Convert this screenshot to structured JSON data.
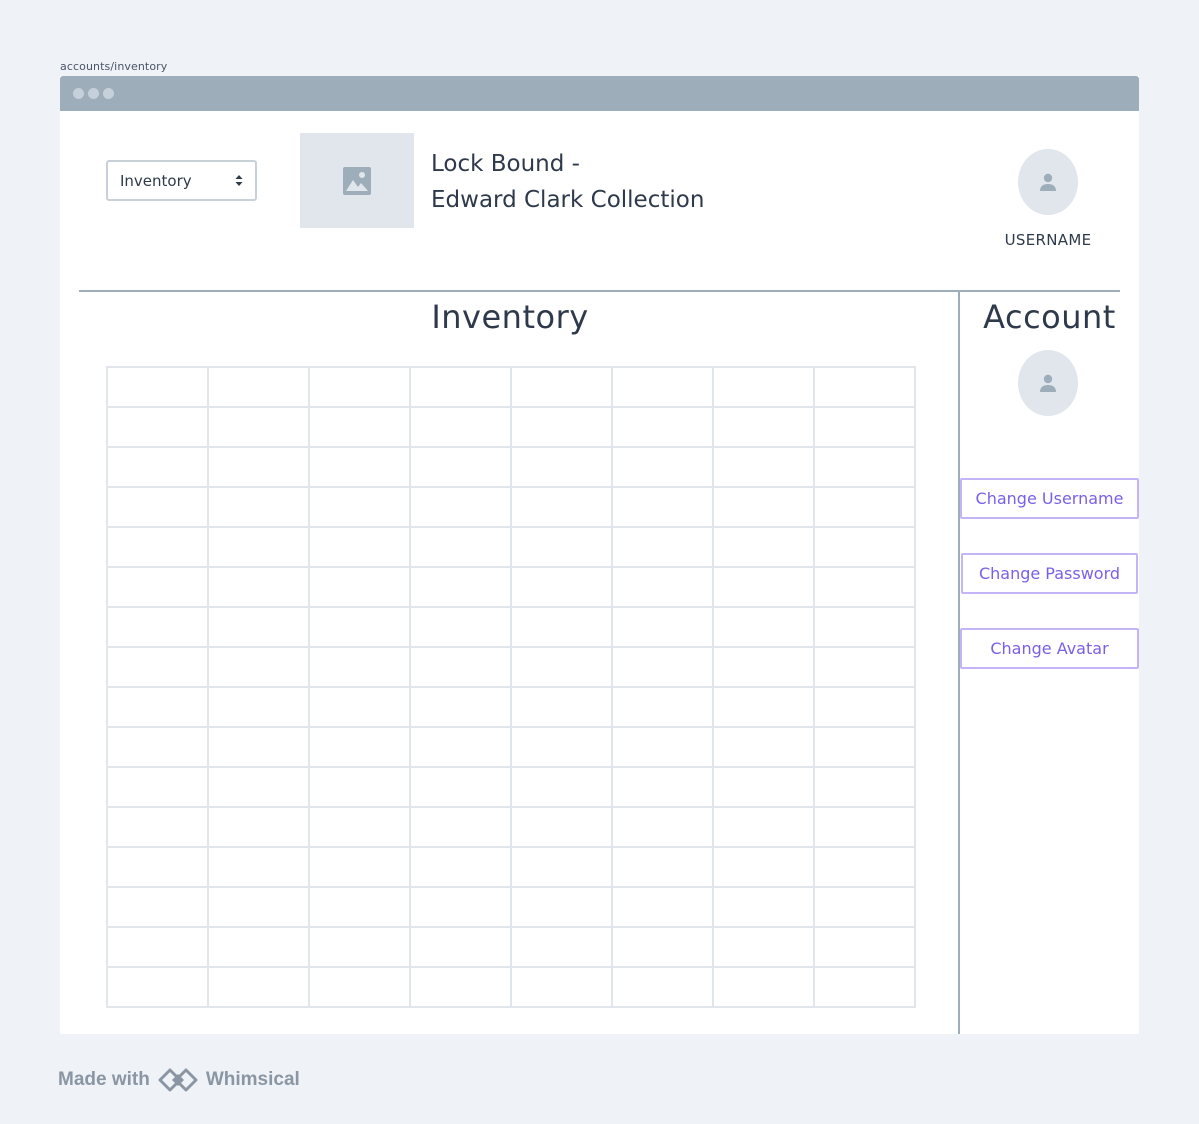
{
  "url": "accounts/inventory",
  "header": {
    "select_value": "Inventory",
    "title_line1": "Lock Bound -",
    "title_line2": "Edward Clark Collection",
    "username": "USERNAME"
  },
  "inventory": {
    "title": "Inventory",
    "rows": 16,
    "columns": 8
  },
  "account": {
    "title": "Account",
    "buttons": {
      "change_username": "Change Username",
      "change_password": "Change Password",
      "change_avatar": "Change Avatar"
    }
  },
  "footer": {
    "made_with": "Made with",
    "brand": "Whimsical"
  },
  "colors": {
    "accent": "#7b5fe8",
    "divider": "#9eadba",
    "placeholder": "#e1e6ec"
  }
}
